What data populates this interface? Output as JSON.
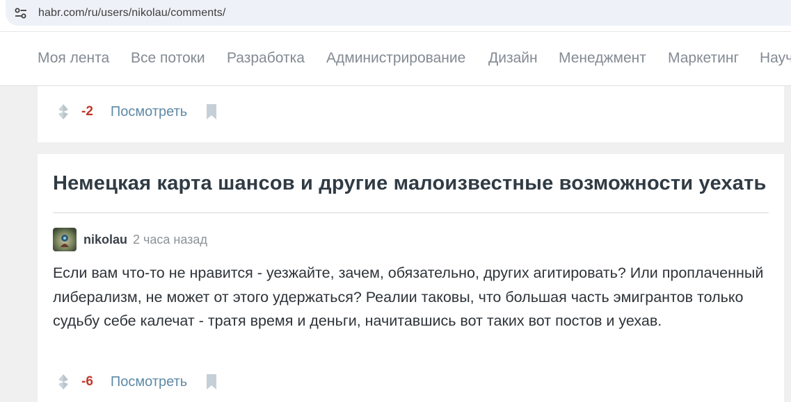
{
  "browser": {
    "url": "habr.com/ru/users/nikolau/comments/"
  },
  "nav": {
    "items": [
      "Моя лента",
      "Все потоки",
      "Разработка",
      "Администрирование",
      "Дизайн",
      "Менеджмент",
      "Маркетинг",
      "Научпоп"
    ]
  },
  "top_card": {
    "score": "-2",
    "view_label": "Посмотреть"
  },
  "main_card": {
    "title": "Немецкая карта шансов и другие малоизвестные возможности уехать",
    "author": "nikolau",
    "time": "2 часа назад",
    "comment": "Если вам что-то не нравится - уезжайте, зачем, обязательно, других агитировать? Или проплаченный либерализм, не может от этого удержаться? Реалии таковы, что большая часть эмигрантов только судьбу себе калечат - тратя время и деньги, начитавшись вот таких вот постов и уехав.",
    "score": "-6",
    "view_label": "Посмотреть"
  },
  "colors": {
    "negative_score": "#c0392b",
    "link": "#5e8aa6",
    "nav_text": "#838a93",
    "page_bg": "#f0f0f0"
  },
  "icons": [
    "site-info-icon",
    "vote-icon",
    "bookmark-icon",
    "avatar"
  ]
}
